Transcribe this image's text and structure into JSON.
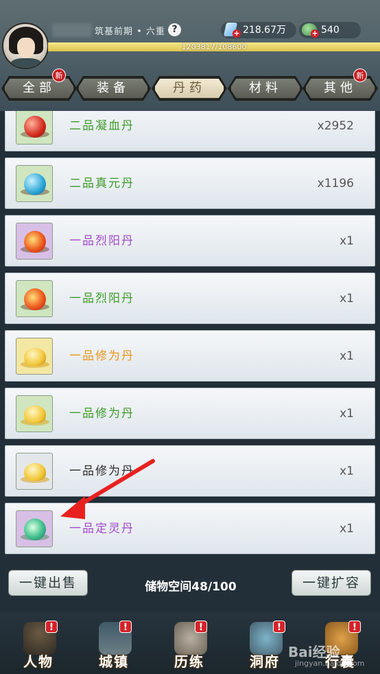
{
  "header": {
    "realm": "筑基前期 • 六重",
    "help_symbol": "?",
    "spirit_stones": "218.67万",
    "jade": "540",
    "xp_text": "1203817/108600",
    "xp_fraction": 1.0
  },
  "tabs": [
    {
      "label": "全部",
      "new_badge": "新"
    },
    {
      "label": "装备",
      "new_badge": ""
    },
    {
      "label": "丹药",
      "new_badge": ""
    },
    {
      "label": "材料",
      "new_badge": ""
    },
    {
      "label": "其他",
      "new_badge": "新"
    }
  ],
  "active_tab": "丹药",
  "items": [
    {
      "name": "二品凝血丹",
      "count": "x2952",
      "name_color": "#3f9b2a",
      "icon": "red-pill-icon"
    },
    {
      "name": "二品真元丹",
      "count": "x1196",
      "name_color": "#3f9b2a",
      "icon": "blue-pill-icon"
    },
    {
      "name": "一品烈阳丹",
      "count": "x1",
      "name_color": "#a44bc8",
      "icon": "flame-pill-icon"
    },
    {
      "name": "一品烈阳丹",
      "count": "x1",
      "name_color": "#3f9b2a",
      "icon": "flame-pill-icon"
    },
    {
      "name": "一品修为丹",
      "count": "x1",
      "name_color": "#e8961a",
      "icon": "gold-ingot-pill-icon"
    },
    {
      "name": "一品修为丹",
      "count": "x1",
      "name_color": "#3f9b2a",
      "icon": "gold-ingot-pill-icon"
    },
    {
      "name": "一品修为丹",
      "count": "x1",
      "name_color": "#2d2d2d",
      "icon": "gold-ingot-pill-icon"
    },
    {
      "name": "一品定灵丹",
      "count": "x1",
      "name_color": "#a44bc8",
      "icon": "green-spirit-pill-icon"
    }
  ],
  "bottom": {
    "sell_label": "一键出售",
    "storage_text": "储物空间48/100",
    "expand_label": "一键扩容"
  },
  "nav": [
    {
      "label": "人物",
      "alert": "!"
    },
    {
      "label": "城镇",
      "alert": "!"
    },
    {
      "label": "历练",
      "alert": "!"
    },
    {
      "label": "洞府",
      "alert": "!"
    },
    {
      "label": "行囊",
      "alert": "!"
    }
  ],
  "watermark": {
    "main": "Bai经验",
    "sub": "jingyan.baidu.com"
  }
}
